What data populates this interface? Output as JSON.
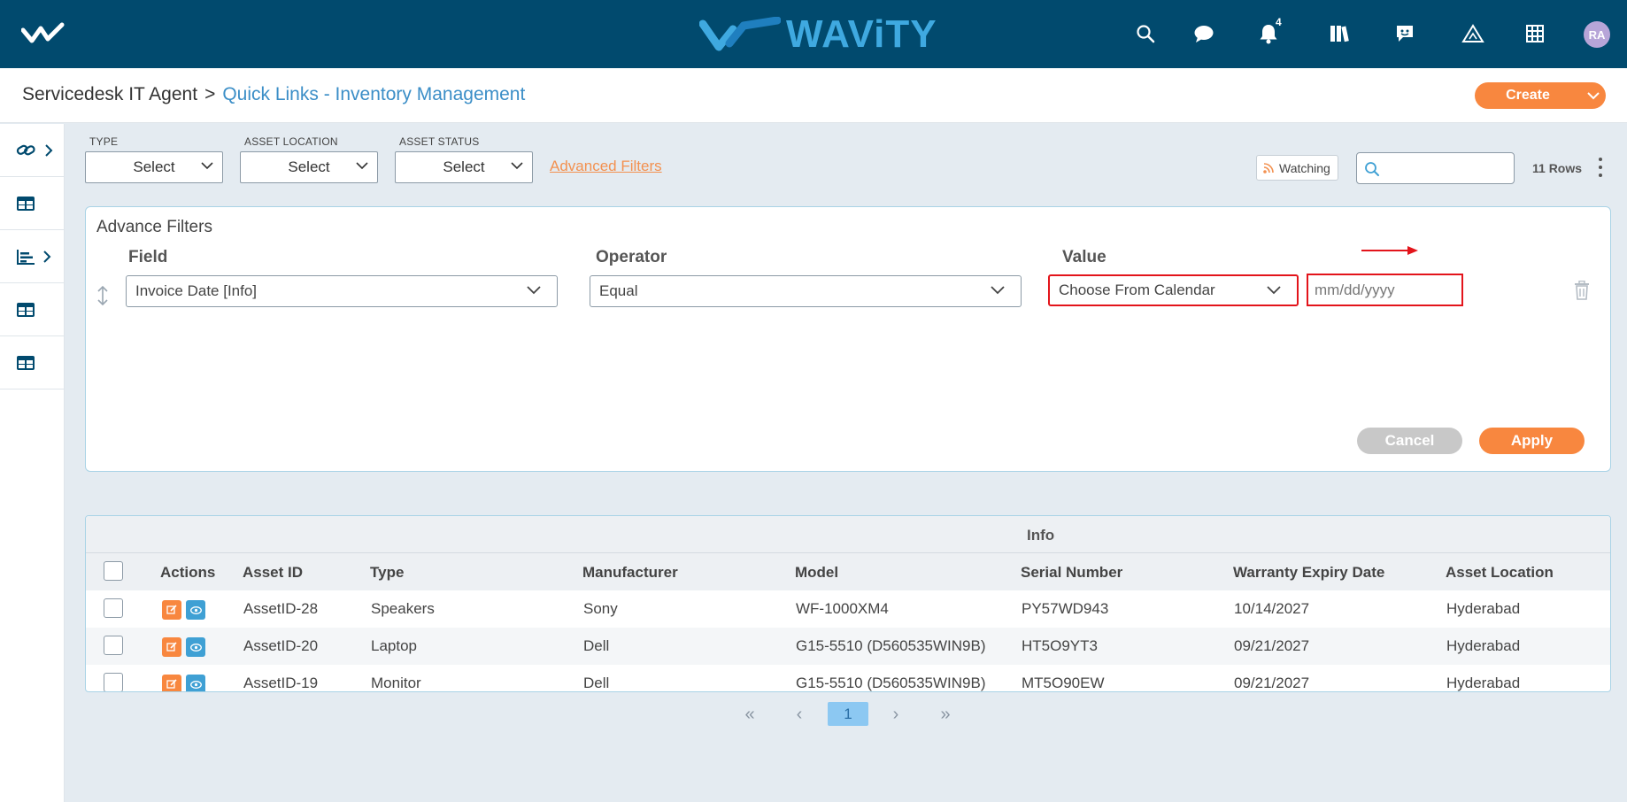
{
  "header": {
    "brand": "WAViTY",
    "notification_count": "4",
    "avatar_initials": "RA",
    "icons": [
      "logo-mark-icon",
      "search-icon",
      "chat-icon",
      "bell-icon",
      "library-icon",
      "message-icon",
      "warning-icon",
      "grid-icon"
    ]
  },
  "breadcrumb": {
    "root": "Servicedesk IT Agent",
    "separator": ">",
    "current": "Quick Links - Inventory Management"
  },
  "create_button": "Create",
  "filters": {
    "type": {
      "label": "TYPE",
      "value": "Select"
    },
    "asset_location": {
      "label": "ASSET LOCATION",
      "value": "Select"
    },
    "asset_status": {
      "label": "ASSET STATUS",
      "value": "Select"
    },
    "advanced_link": "Advanced Filters",
    "watching": "Watching",
    "search_placeholder": "",
    "rows": "11 Rows"
  },
  "advance_filters": {
    "title": "Advance Filters",
    "field_header": "Field",
    "operator_header": "Operator",
    "value_header": "Value",
    "field_value": "Invoice Date [Info]",
    "operator_value": "Equal",
    "value_type": "Choose From Calendar",
    "date_placeholder": "mm/dd/yyyy",
    "cancel": "Cancel",
    "apply": "Apply"
  },
  "table": {
    "group_header": "Info",
    "columns": [
      "Actions",
      "Asset ID",
      "Type",
      "Manufacturer",
      "Model",
      "Serial Number",
      "Warranty Expiry Date",
      "Asset Location"
    ],
    "rows": [
      {
        "asset_id": "AssetID-28",
        "type": "Speakers",
        "manufacturer": "Sony",
        "model": "WF-1000XM4",
        "serial": "PY57WD943",
        "warranty": "10/14/2027",
        "location": "Hyderabad"
      },
      {
        "asset_id": "AssetID-20",
        "type": "Laptop",
        "manufacturer": "Dell",
        "model": "G15-5510 (D560535WIN9B)",
        "serial": "HT5O9YT3",
        "warranty": "09/21/2027",
        "location": "Hyderabad"
      },
      {
        "asset_id": "AssetID-19",
        "type": "Monitor",
        "manufacturer": "Dell",
        "model": "G15-5510 (D560535WIN9B)",
        "serial": "MT5O90EW",
        "warranty": "09/21/2027",
        "location": "Hyderabad"
      }
    ]
  },
  "pagination": {
    "first": "«",
    "prev": "‹",
    "current_page": "1",
    "next": "›",
    "last": "»"
  },
  "colors": {
    "topbar": "#014a6e",
    "brand": "#3fa9e0",
    "accent_orange": "#f8873f",
    "link_blue": "#3b8ec7",
    "highlight_red": "#e3141b"
  }
}
